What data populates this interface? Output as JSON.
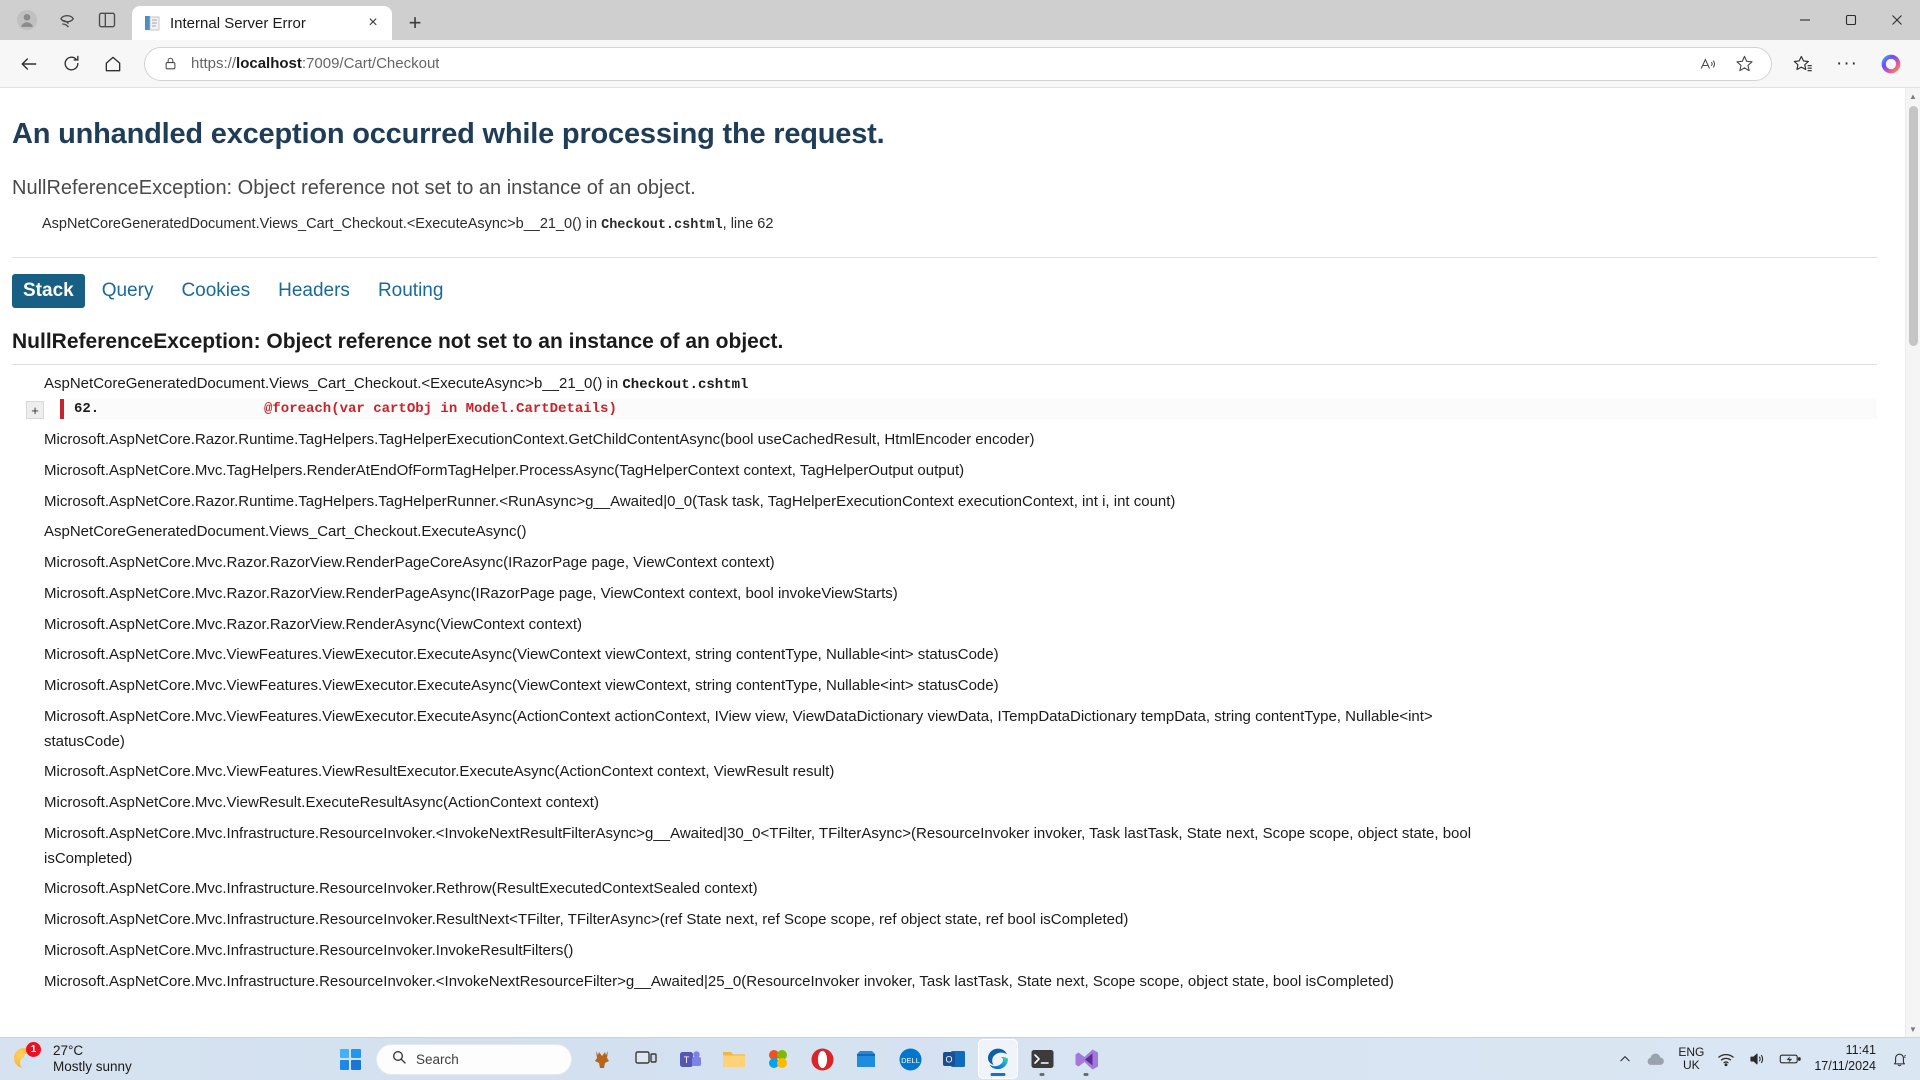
{
  "browser": {
    "tab": {
      "title": "Internal Server Error",
      "favicon": "document-icon"
    },
    "new_tab_label": "+",
    "close_label": "×",
    "window_controls": {
      "minimize": "—",
      "maximize": "❐",
      "close": "✕"
    },
    "nav": {
      "back": "back-arrow",
      "reload": "reload-icon",
      "home": "home-icon"
    },
    "address": {
      "scheme": "https://",
      "host": "localhost",
      "path": ":7009/Cart/Checkout",
      "full": "https://localhost:7009/Cart/Checkout",
      "lock": "lock-icon",
      "read_aloud": "read-aloud-icon",
      "favorite": "star-icon"
    },
    "toolbar_right": {
      "collections": "collections-icon",
      "settings_more": "···",
      "copilot": "copilot-icon"
    }
  },
  "error_page": {
    "title": "An unhandled exception occurred while processing the request.",
    "subtitle": "NullReferenceException: Object reference not set to an instance of an object.",
    "location_prefix": "AspNetCoreGeneratedDocument.Views_Cart_Checkout.<ExecuteAsync>b__21_0() in ",
    "location_file": "Checkout.cshtml",
    "location_suffix": ", line 62",
    "accent_color": "#175f85",
    "title_color": "#1f3d57",
    "code_color": "#c7252b",
    "tabs": [
      {
        "label": "Stack",
        "active": true
      },
      {
        "label": "Query",
        "active": false
      },
      {
        "label": "Cookies",
        "active": false
      },
      {
        "label": "Headers",
        "active": false
      },
      {
        "label": "Routing",
        "active": false
      }
    ],
    "exception_heading": "NullReferenceException: Object reference not set to an instance of an object.",
    "frame_title_prefix": "AspNetCoreGeneratedDocument.Views_Cart_Checkout.<ExecuteAsync>b__21_0() in ",
    "frame_title_file": "Checkout.cshtml",
    "expander_label": "+",
    "code": {
      "line_number": "62.",
      "source": "@foreach(var cartObj in Model.CartDetails)"
    },
    "stack_lines": [
      "Microsoft.AspNetCore.Razor.Runtime.TagHelpers.TagHelperExecutionContext.GetChildContentAsync(bool useCachedResult, HtmlEncoder encoder)",
      "Microsoft.AspNetCore.Mvc.TagHelpers.RenderAtEndOfFormTagHelper.ProcessAsync(TagHelperContext context, TagHelperOutput output)",
      "Microsoft.AspNetCore.Razor.Runtime.TagHelpers.TagHelperRunner.<RunAsync>g__Awaited|0_0(Task task, TagHelperExecutionContext executionContext, int i, int count)",
      "AspNetCoreGeneratedDocument.Views_Cart_Checkout.ExecuteAsync()",
      "Microsoft.AspNetCore.Mvc.Razor.RazorView.RenderPageCoreAsync(IRazorPage page, ViewContext context)",
      "Microsoft.AspNetCore.Mvc.Razor.RazorView.RenderPageAsync(IRazorPage page, ViewContext context, bool invokeViewStarts)",
      "Microsoft.AspNetCore.Mvc.Razor.RazorView.RenderAsync(ViewContext context)",
      "Microsoft.AspNetCore.Mvc.ViewFeatures.ViewExecutor.ExecuteAsync(ViewContext viewContext, string contentType, Nullable<int> statusCode)",
      "Microsoft.AspNetCore.Mvc.ViewFeatures.ViewExecutor.ExecuteAsync(ViewContext viewContext, string contentType, Nullable<int> statusCode)",
      "Microsoft.AspNetCore.Mvc.ViewFeatures.ViewExecutor.ExecuteAsync(ActionContext actionContext, IView view, ViewDataDictionary viewData, ITempDataDictionary tempData, string contentType, Nullable<int> statusCode)",
      "Microsoft.AspNetCore.Mvc.ViewFeatures.ViewResultExecutor.ExecuteAsync(ActionContext context, ViewResult result)",
      "Microsoft.AspNetCore.Mvc.ViewResult.ExecuteResultAsync(ActionContext context)",
      "Microsoft.AspNetCore.Mvc.Infrastructure.ResourceInvoker.<InvokeNextResultFilterAsync>g__Awaited|30_0<TFilter, TFilterAsync>(ResourceInvoker invoker, Task lastTask, State next, Scope scope, object state, bool isCompleted)",
      "Microsoft.AspNetCore.Mvc.Infrastructure.ResourceInvoker.Rethrow(ResultExecutedContextSealed context)",
      "Microsoft.AspNetCore.Mvc.Infrastructure.ResourceInvoker.ResultNext<TFilter, TFilterAsync>(ref State next, ref Scope scope, ref object state, ref bool isCompleted)",
      "Microsoft.AspNetCore.Mvc.Infrastructure.ResourceInvoker.InvokeResultFilters()",
      "Microsoft.AspNetCore.Mvc.Infrastructure.ResourceInvoker.<InvokeNextResourceFilter>g__Awaited|25_0(ResourceInvoker invoker, Task lastTask, State next, Scope scope, object state, bool isCompleted)"
    ]
  },
  "taskbar": {
    "weather": {
      "temperature": "27°C",
      "description": "Mostly sunny",
      "badge": "1",
      "icon": "sun-cloud-icon"
    },
    "start_button": "windows-logo-icon",
    "search": {
      "placeholder": "Search",
      "icon": "search-icon"
    },
    "apps": [
      {
        "name": "deer-widget-icon",
        "label": ""
      },
      {
        "name": "task-view-icon",
        "label": ""
      },
      {
        "name": "teams-icon",
        "label": ""
      },
      {
        "name": "file-explorer-icon",
        "label": ""
      },
      {
        "name": "photos-icon",
        "label": ""
      },
      {
        "name": "opera-icon",
        "label": "O"
      },
      {
        "name": "microsoft-store-icon",
        "label": ""
      },
      {
        "name": "dell-icon",
        "label": "DELL"
      },
      {
        "name": "outlook-icon",
        "label": ""
      },
      {
        "name": "microsoft-edge-icon",
        "label": ""
      },
      {
        "name": "terminal-icon",
        "label": ""
      },
      {
        "name": "visual-studio-icon",
        "label": ""
      }
    ],
    "tray": {
      "show_hidden": "chevron-up-icon",
      "onedrive": "cloud-icon",
      "language": {
        "line1": "ENG",
        "line2": "UK"
      },
      "wifi": "wifi-icon",
      "volume": "speaker-icon",
      "battery": "battery-icon",
      "time": "11:41",
      "date": "17/11/2024",
      "notifications": "notification-bell-icon"
    }
  }
}
